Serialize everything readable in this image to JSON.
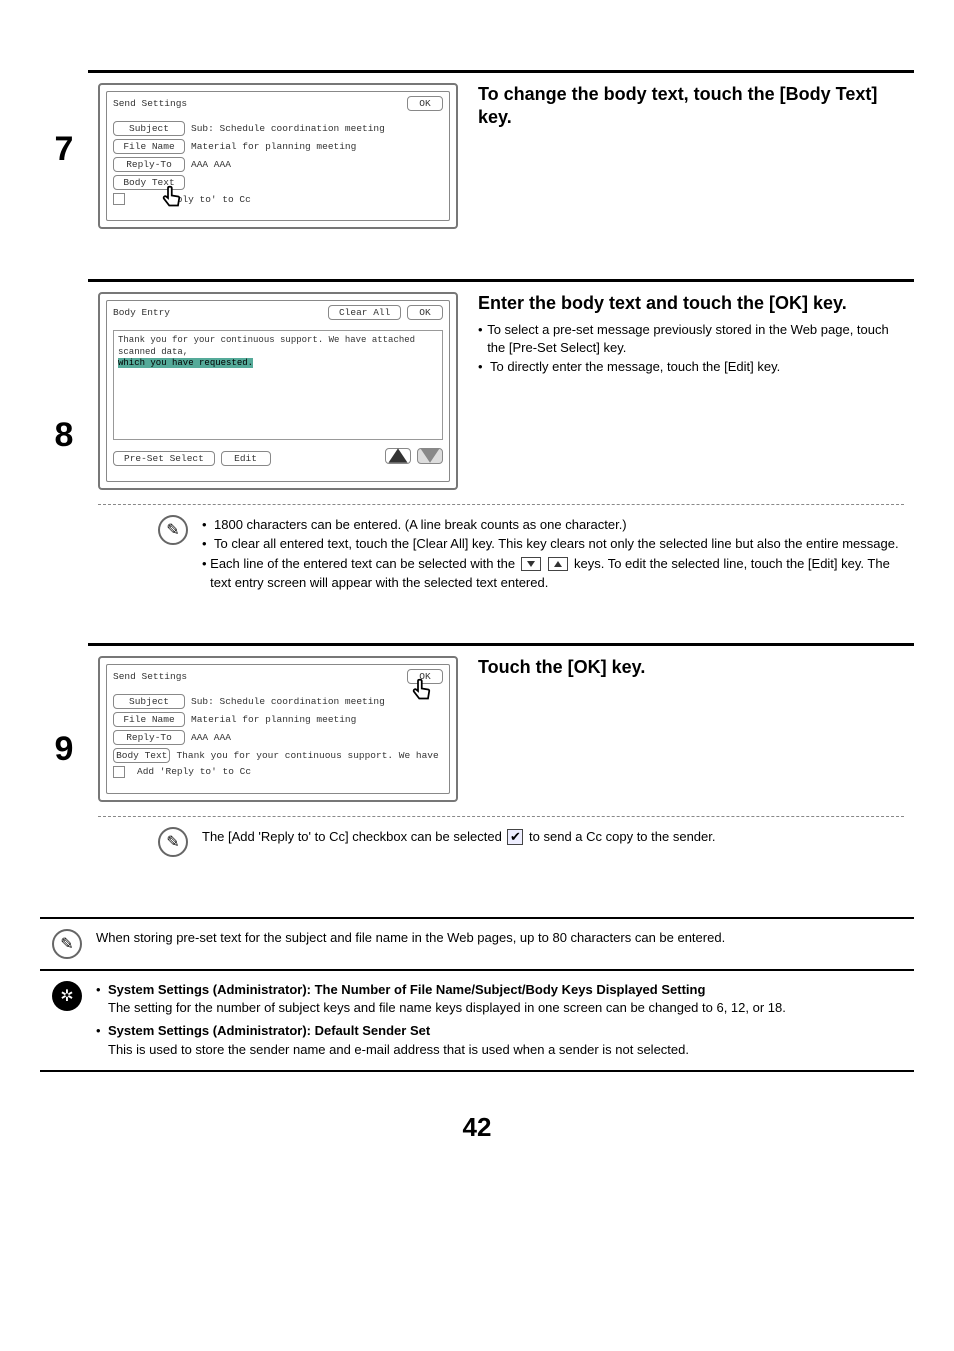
{
  "page_number": "42",
  "step7": {
    "number": "7",
    "heading": "To change the body text, touch the [Body Text] key.",
    "panel": {
      "title": "Send Settings",
      "ok": "OK",
      "rows": {
        "subject_label": "Subject",
        "subject_val": "Sub: Schedule coordination meeting",
        "filename_label": "File Name",
        "filename_val": "Material for planning meeting",
        "replyto_label": "Reply-To",
        "replyto_val": "AAA AAA",
        "bodytext_label": "Body Text",
        "cc_frag": "eply to' to Cc"
      }
    }
  },
  "step8": {
    "number": "8",
    "heading": "Enter the body text and touch the [OK] key.",
    "sub1": "To select a pre-set message previously stored in the Web page, touch the [Pre-Set Select] key.",
    "sub2": "To directly enter the message, touch the [Edit] key.",
    "panel": {
      "title": "Body Entry",
      "clear_all": "Clear All",
      "ok": "OK",
      "line1": "Thank you for your continuous support. We have attached scanned data,",
      "line2": "which you have requested.",
      "preset": "Pre-Set Select",
      "edit": "Edit"
    },
    "notes": {
      "n1": "1800 characters can be entered. (A line break counts as one character.)",
      "n2": "To clear all entered text, touch the [Clear All] key. This key clears not only the selected line but also the entire message.",
      "n3a": "Each line of the entered text can be selected with the ",
      "n3b": " keys. To edit the selected line, touch the [Edit] key. The text entry screen will appear with the selected text entered."
    }
  },
  "step9": {
    "number": "9",
    "heading": "Touch the [OK] key.",
    "panel": {
      "title": "Send Settings",
      "ok": "OK",
      "rows": {
        "subject_label": "Subject",
        "subject_val": "Sub: Schedule coordination meeting",
        "filename_label": "File Name",
        "filename_val": "Material for planning meeting",
        "replyto_label": "Reply-To",
        "replyto_val": "AAA AAA",
        "bodytext_label": "Body Text",
        "bodytext_val": "Thank you for your continuous support. We have attached sca",
        "cc": "Add 'Reply to' to Cc"
      }
    },
    "note_a": "The [Add 'Reply to' to Cc] checkbox can be selected ",
    "note_b": " to send a Cc copy to the sender."
  },
  "footer": {
    "note1": "When storing pre-set text for the subject and file name in the Web pages, up to 80 characters can be entered.",
    "admin": {
      "b1_title": "System Settings (Administrator): The Number of File Name/Subject/Body Keys Displayed Setting",
      "b1_body": "The setting for the number of subject keys and file name keys displayed in one screen can be changed to 6, 12, or 18.",
      "b2_title": "System Settings (Administrator): Default Sender Set",
      "b2_body": "This is used to store the sender name and e-mail address that is used when a sender is not selected."
    }
  }
}
